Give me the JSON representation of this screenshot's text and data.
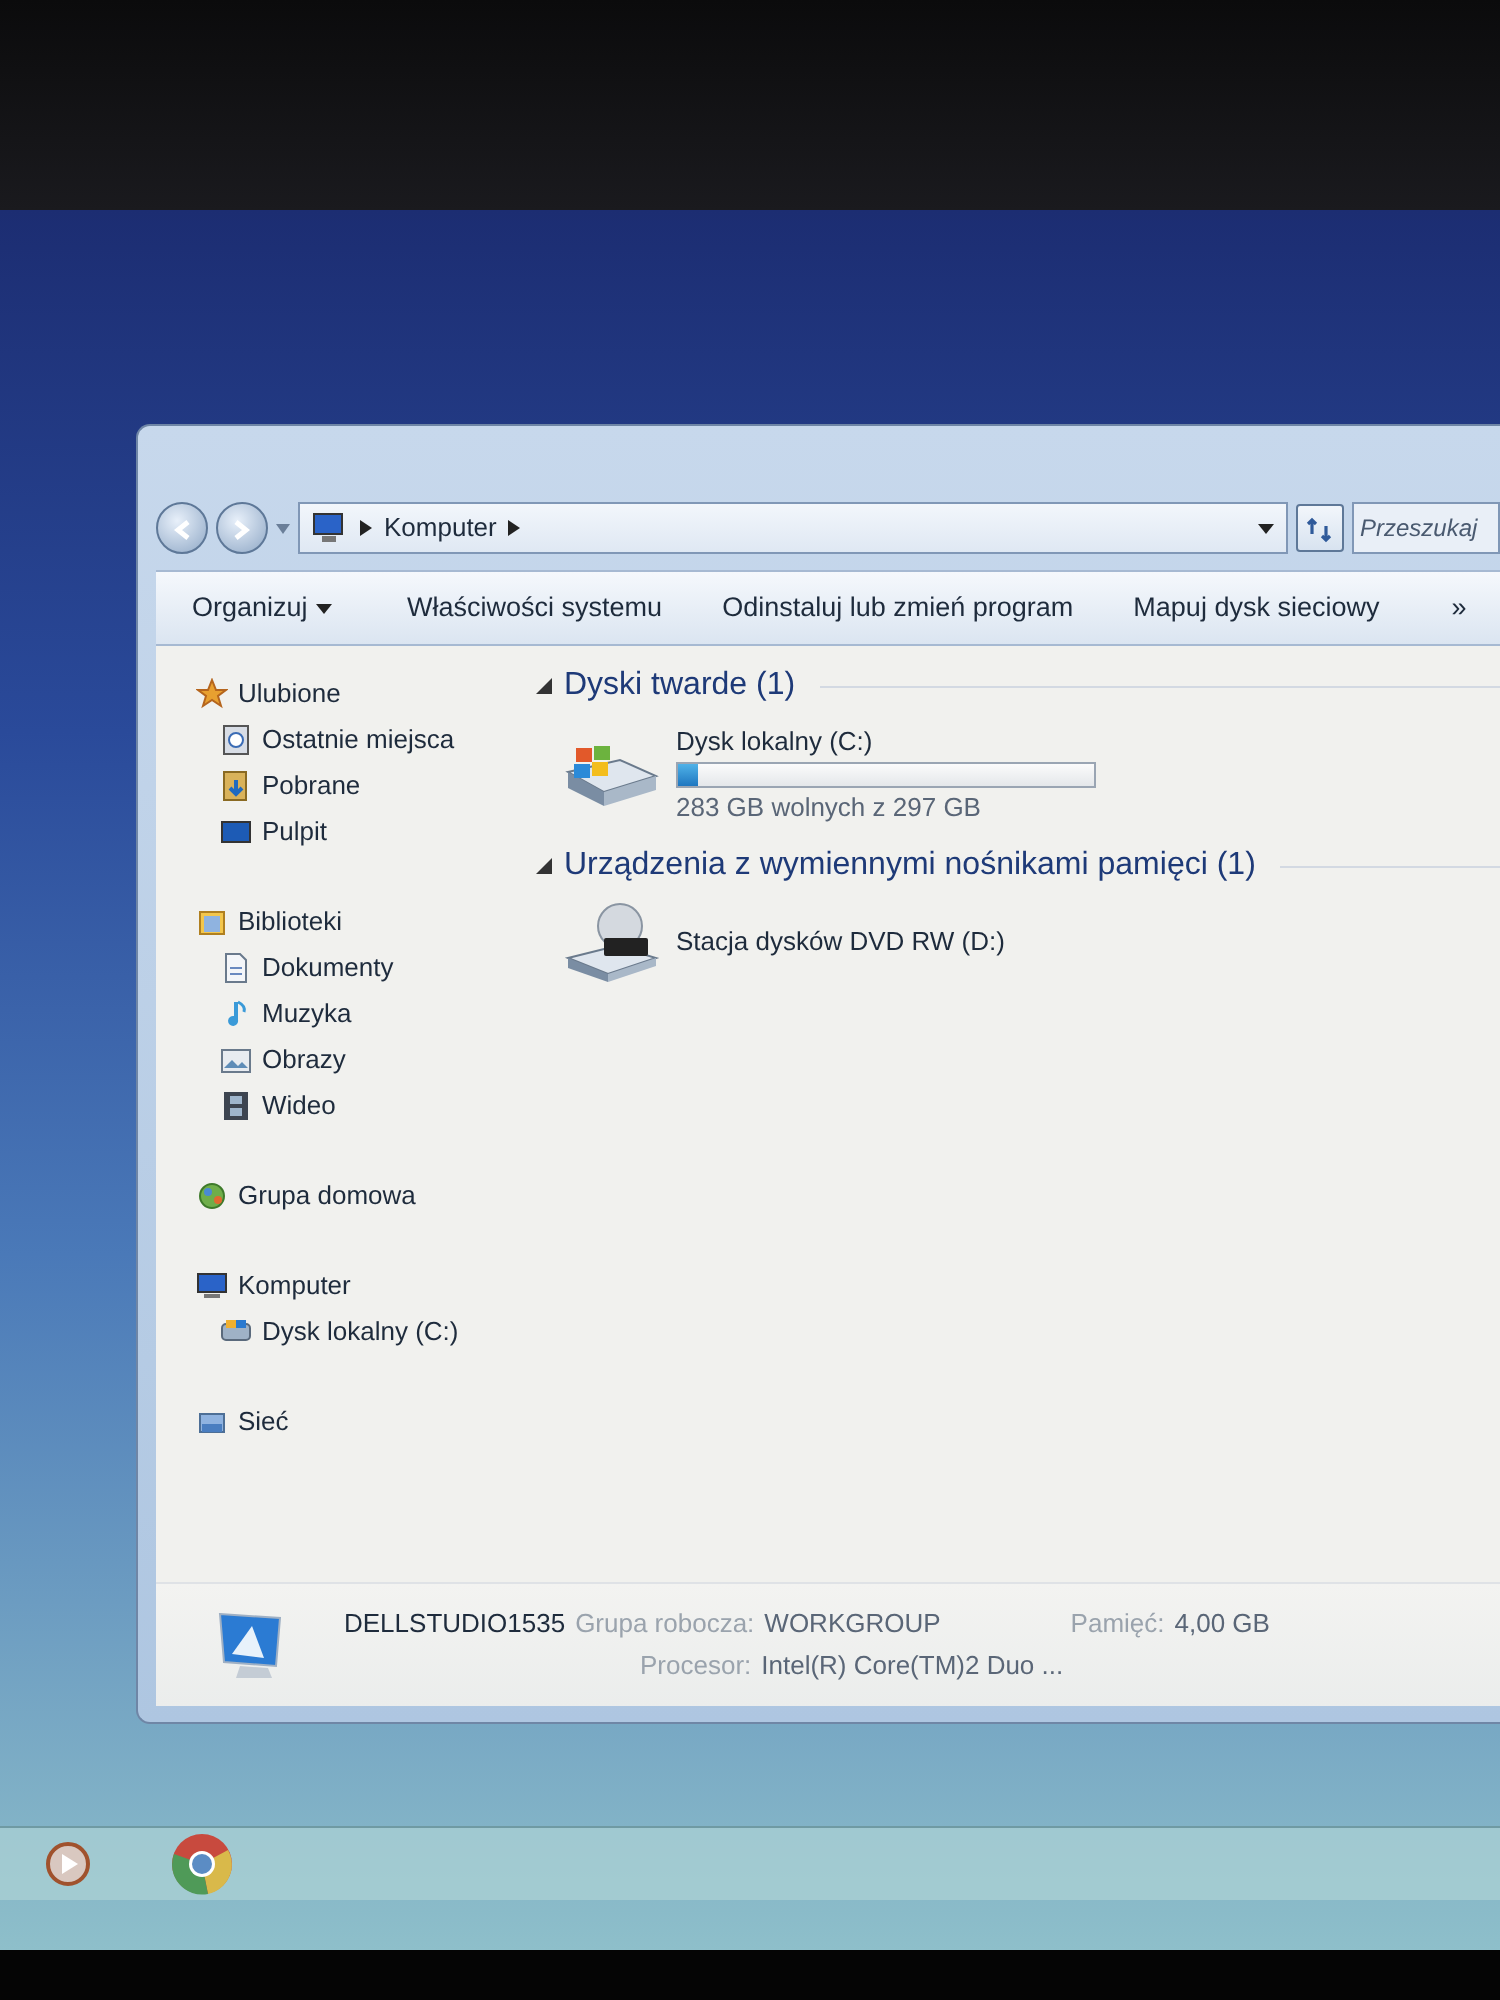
{
  "address_bar": {
    "path": [
      "Komputer"
    ],
    "search_placeholder": "Przeszukaj"
  },
  "toolbar": [
    {
      "kind": "menu",
      "label": "Organizuj"
    },
    {
      "kind": "button",
      "label": "Właściwości systemu"
    },
    {
      "kind": "button",
      "label": "Odinstaluj lub zmień program"
    },
    {
      "kind": "button",
      "label": "Mapuj dysk sieciowy"
    },
    {
      "kind": "overflow",
      "label": "»"
    }
  ],
  "sidebar": {
    "groups": [
      {
        "label": "Ulubione",
        "children": [
          {
            "label": "Ostatnie miejsca"
          },
          {
            "label": "Pobrane"
          },
          {
            "label": "Pulpit"
          }
        ]
      },
      {
        "label": "Biblioteki",
        "children": [
          {
            "label": "Dokumenty"
          },
          {
            "label": "Muzyka"
          },
          {
            "label": "Obrazy"
          },
          {
            "label": "Wideo"
          }
        ]
      },
      {
        "label": "Grupa domowa"
      },
      {
        "label": "Komputer",
        "children": [
          {
            "label": "Dysk lokalny (C:)"
          }
        ]
      },
      {
        "label": "Sieć"
      }
    ]
  },
  "sections": [
    {
      "title": "Dyski twarde (1)",
      "expanded": true,
      "items": [
        {
          "kind": "disk",
          "name": "Dysk lokalny (C:)",
          "level": 0.05,
          "reading": "283 GB wolnych z 297 GB"
        }
      ]
    },
    {
      "title": "Urządzenia z wymiennymi nośnikami pamięci (1)",
      "expanded": true,
      "items": [
        {
          "kind": "dvd",
          "name": "Stacja dysków DVD RW (D:)"
        }
      ]
    }
  ],
  "details": {
    "computer_name": "DELLSTUDIO1535",
    "fields": [
      {
        "label": "Grupa robocza:",
        "value": "WORKGROUP"
      },
      {
        "label": "Pamięć:",
        "value": "4,00 GB"
      },
      {
        "label": "Procesor:",
        "value": "Intel(R) Core(TM)2 Duo ..."
      }
    ]
  }
}
